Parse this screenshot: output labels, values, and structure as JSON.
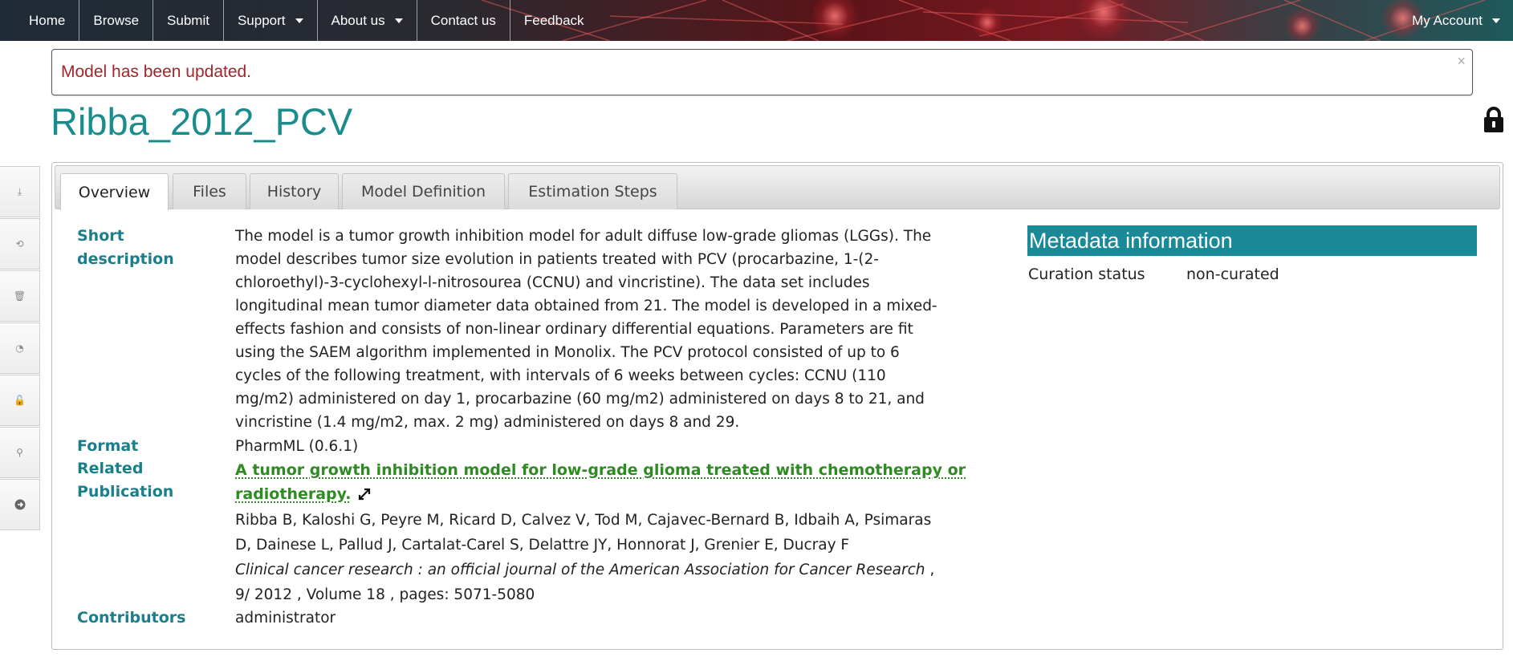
{
  "nav": {
    "items": [
      "Home",
      "Browse",
      "Submit",
      "Support",
      "About us",
      "Contact us",
      "Feedback"
    ],
    "account": "My Account"
  },
  "alert": {
    "message": "Model has been updated.",
    "close": "×"
  },
  "model": {
    "title": "Ribba_2012_PCV"
  },
  "sidebar": {
    "icons": [
      "download-icon",
      "convert-icon",
      "delete-icon",
      "rss-icon",
      "unlock-icon",
      "publish-icon",
      "arrow-right-icon"
    ]
  },
  "tabs": [
    "Overview",
    "Files",
    "History",
    "Model Definition",
    "Estimation Steps"
  ],
  "overview": {
    "short_description_label": [
      "Short",
      "description"
    ],
    "short_description_lines": [
      "The model is a tumor growth inhibition model for adult diffuse low-grade gliomas (LGGs). The",
      "model describes tumor size evolution in patients treated with PCV (procarbazine, 1-(2-",
      "chloroethyl)-3-cyclohexyl-l-nitrosourea (CCNU) and vincristine). The data set includes",
      "longitudinal mean tumor diameter data obtained from 21. The model is developed in a mixed-",
      "effects fashion and consists of non-linear ordinary differential equations. Parameters are fit",
      "using the SAEM algorithm implemented in Monolix. The PCV protocol consisted of up to 6",
      "cycles of the following treatment, with intervals of 6 weeks between cycles: CCNU (110",
      "mg/m2) administered on day 1, procarbazine (60 mg/m2) administered on days 8 to 21, and",
      "vincristine (1.4 mg/m2, max. 2 mg) administered on days 8 and 29."
    ],
    "format_label": "Format",
    "format_value": "PharmML (0.6.1)",
    "publication_label": [
      "Related",
      "Publication"
    ],
    "publication_title_lines": [
      "A tumor growth inhibition model for low-grade glioma treated with chemotherapy or",
      "radiotherapy."
    ],
    "authors_lines": [
      "Ribba B, Kaloshi G, Peyre M, Ricard D, Calvez V, Tod M, Cajavec-Bernard B, Idbaih A, Psimaras",
      "D, Dainese L, Pallud J, Cartalat-Carel S, Delattre JY, Honnorat J, Grenier E, Ducray F"
    ],
    "journal": "Clinical cancer research : an official journal of the American Association for Cancer Research",
    "journal_suffix": " ,",
    "citation_line": "9/ 2012 , Volume 18 , pages: 5071-5080",
    "contributors_label": "Contributors",
    "contributors_value": "administrator"
  },
  "metadata": {
    "header": "Metadata information",
    "curation_label": "Curation status",
    "curation_value": "non-curated"
  },
  "colors": {
    "accent": "#1a8c8c",
    "label": "#1a7f8a",
    "link": "#2e8b22",
    "alert_text": "#a0262a",
    "meta_header_bg": "#1a8a99"
  }
}
